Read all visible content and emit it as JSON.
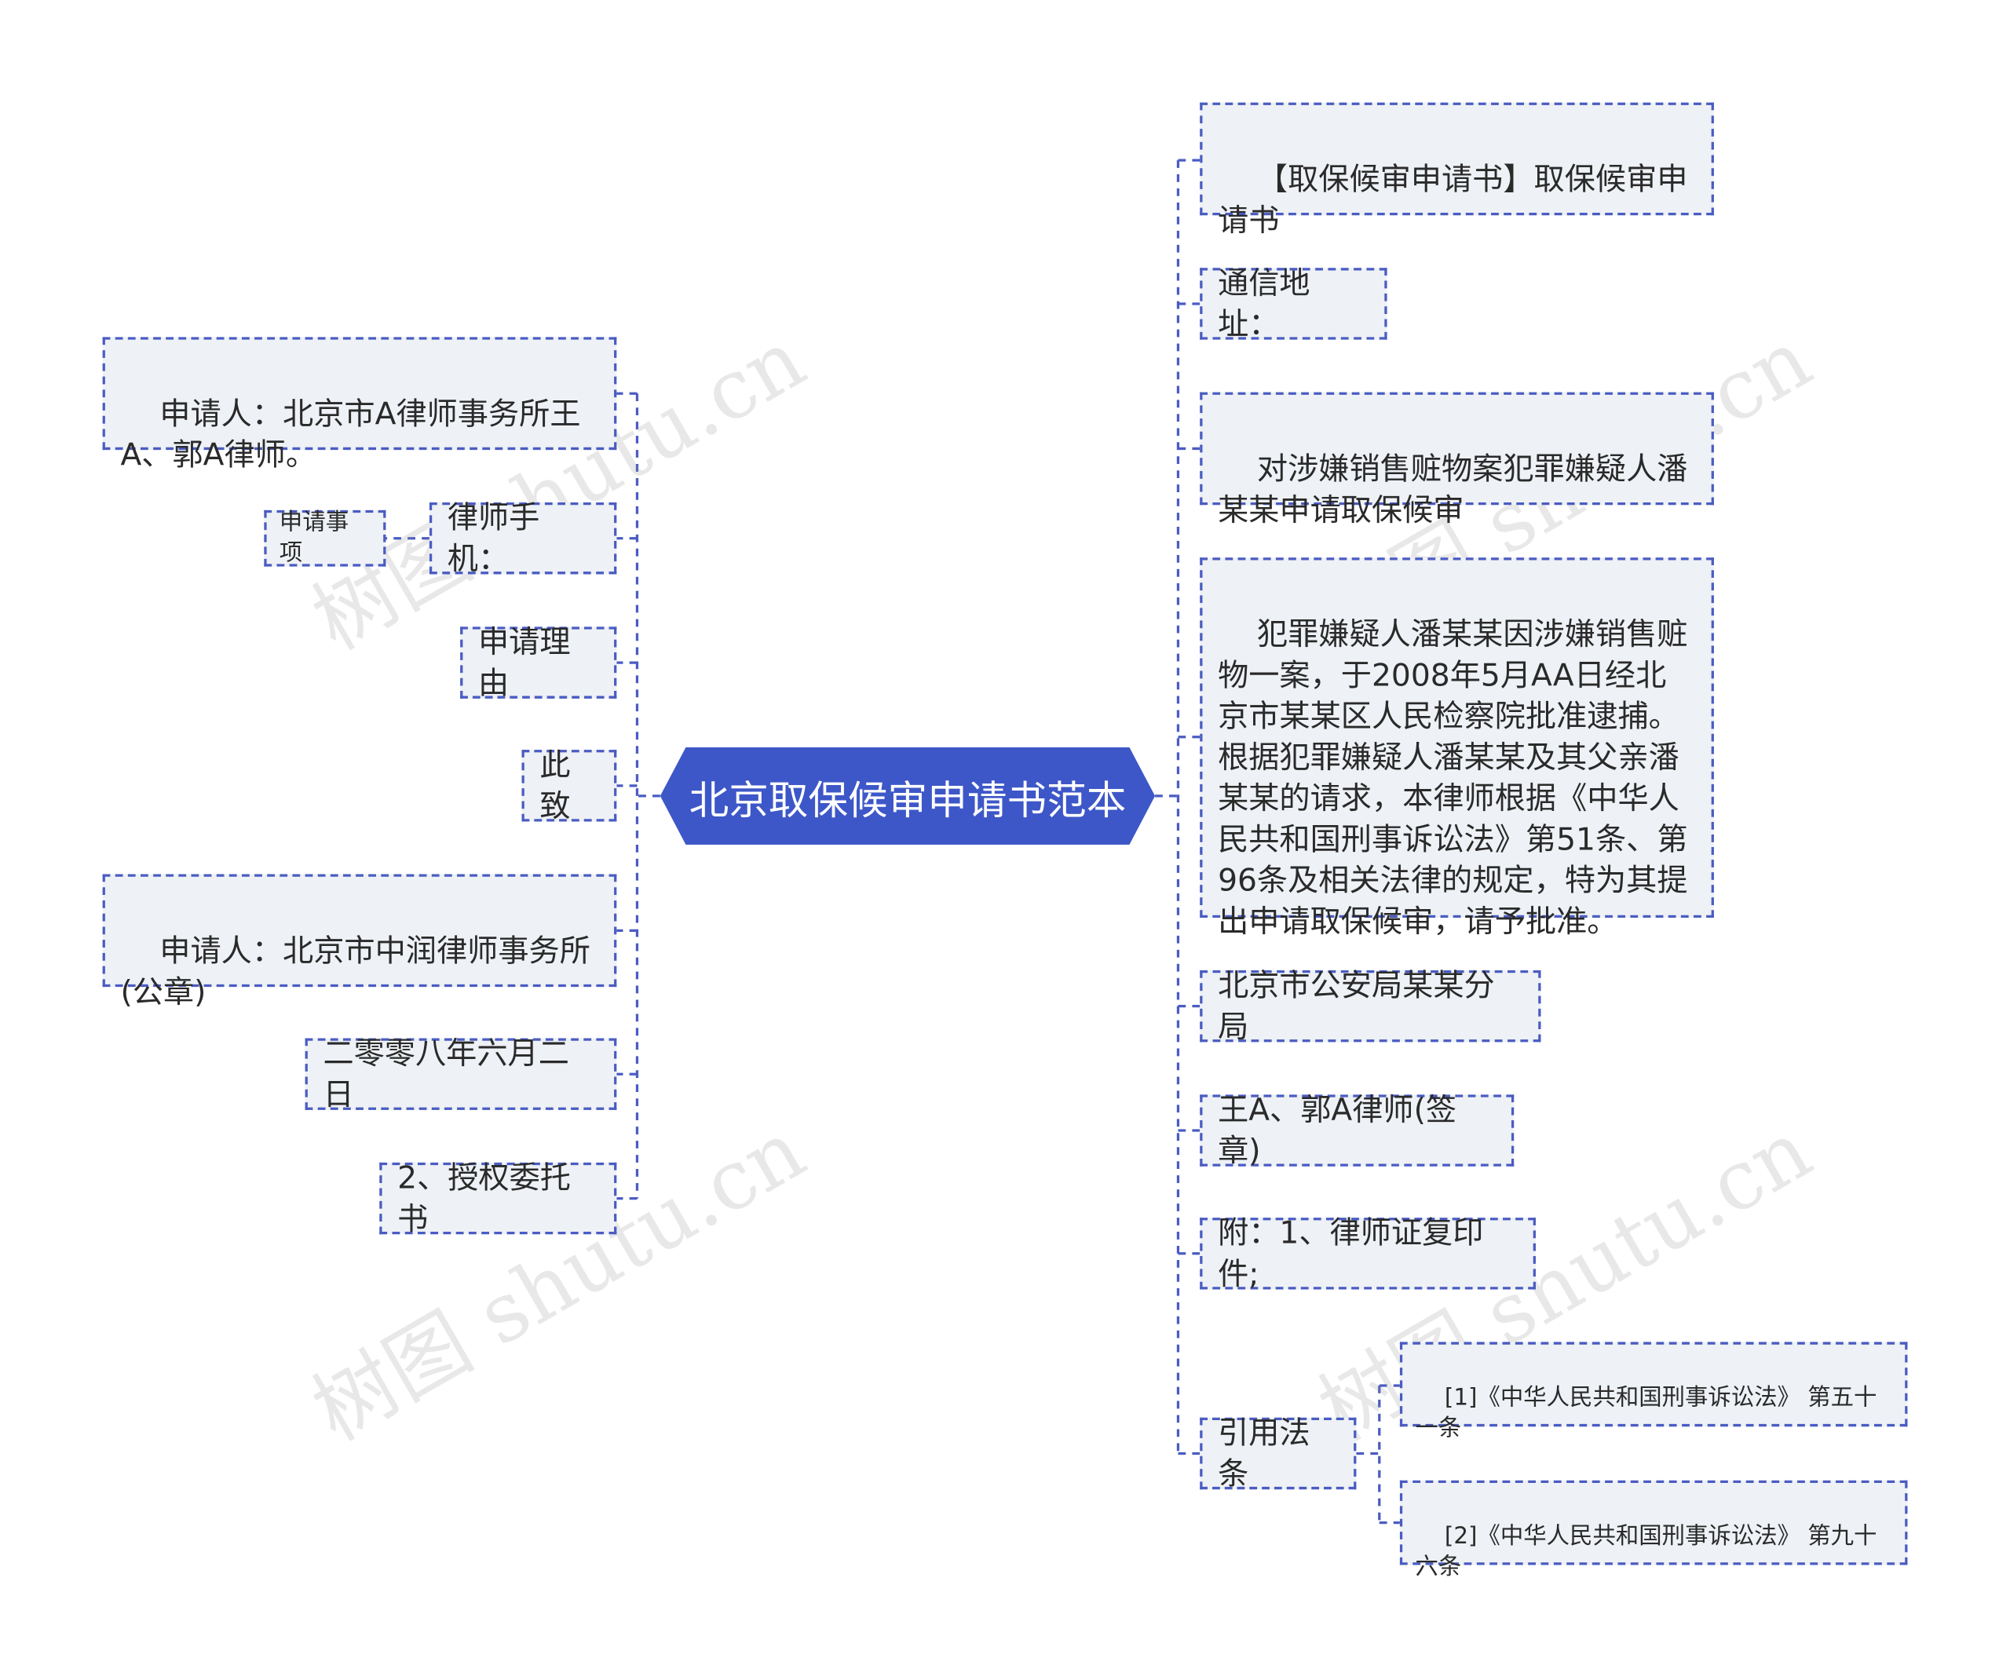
{
  "root": {
    "label": "北京取保候审申请书范本"
  },
  "left_nodes": [
    {
      "id": "applicant-lawyers",
      "text": "申请人：北京市A律师事务所王A、郭A律师。"
    },
    {
      "id": "lawyer-phone",
      "text": "律师手机："
    },
    {
      "id": "application-reason",
      "text": "申请理由"
    },
    {
      "id": "cizhi",
      "text": "此致"
    },
    {
      "id": "applicant-firm",
      "text": "申请人：北京市中润律师事务所(公章)"
    },
    {
      "id": "date",
      "text": "二零零八年六月二日"
    },
    {
      "id": "authorization",
      "text": "2、授权委托书"
    }
  ],
  "left_child": {
    "id": "application-matters",
    "text": "申请事项"
  },
  "right_nodes": [
    {
      "id": "title",
      "text": "【取保候审申请书】取保候审申请书"
    },
    {
      "id": "address",
      "text": "通信地址："
    },
    {
      "id": "case",
      "text": "对涉嫌销售赃物案犯罪嫌疑人潘某某申请取保候审"
    },
    {
      "id": "body",
      "text": "犯罪嫌疑人潘某某因涉嫌销售赃物一案，于2008年5月AA日经北京市某某区人民检察院批准逮捕。根据犯罪嫌疑人潘某某及其父亲潘某某的请求，本律师根据《中华人民共和国刑事诉讼法》第51条、第96条及相关法律的规定，特为其提出申请取保候审，请予批准。"
    },
    {
      "id": "police",
      "text": "北京市公安局某某分局"
    },
    {
      "id": "signature",
      "text": "王A、郭A律师(签章)"
    },
    {
      "id": "attachment",
      "text": "附：1、律师证复印件;"
    },
    {
      "id": "citations",
      "text": "引用法条"
    }
  ],
  "citation_children": [
    {
      "id": "citation-1",
      "text": "[1]《中华人民共和国刑事诉讼法》 第五十一条"
    },
    {
      "id": "citation-2",
      "text": "[2]《中华人民共和国刑事诉讼法》 第九十六条"
    }
  ],
  "watermark": "树图 shutu.cn",
  "colors": {
    "root": "#3d57c8",
    "line": "#4a5cc2",
    "node_bg": "#eef1f5"
  }
}
